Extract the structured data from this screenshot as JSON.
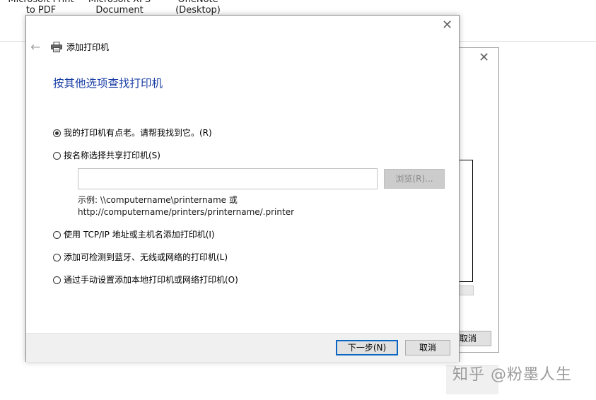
{
  "background": {
    "printer_labels": [
      "Microsoft Print\nto PDF",
      "Microsoft XPS\nDocument",
      "OneNote\n(Desktop)"
    ],
    "behind_dialog": {
      "close_glyph": "✕",
      "cancel_label": "取消"
    }
  },
  "dialog": {
    "close_glyph": "✕",
    "back_glyph": "←",
    "title": "添加打印机",
    "heading": "按其他选项查找打印机",
    "options": [
      {
        "label": "我的打印机有点老。请帮我找到它。(R)",
        "selected": true
      },
      {
        "label": "按名称选择共享打印机(S)",
        "selected": false
      },
      {
        "label": "使用 TCP/IP 地址或主机名添加打印机(I)",
        "selected": false
      },
      {
        "label": "添加可检测到蓝牙、无线或网络的打印机(L)",
        "selected": false
      },
      {
        "label": "通过手动设置添加本地打印机或网络打印机(O)",
        "selected": false
      }
    ],
    "shared_printer_input": {
      "value": "",
      "placeholder": ""
    },
    "browse_label": "浏览(R)...",
    "example_line1": "示例: \\\\computername\\printername 或",
    "example_line2": "http://computername/printers/printername/.printer",
    "next_label": "下一步(N)",
    "cancel_label": "取消"
  },
  "watermark": "知乎 @粉墨人生",
  "colors": {
    "heading": "#1a3ea5",
    "default_button_border": "#0b66c3",
    "footer_bg": "#f0f0f0"
  }
}
